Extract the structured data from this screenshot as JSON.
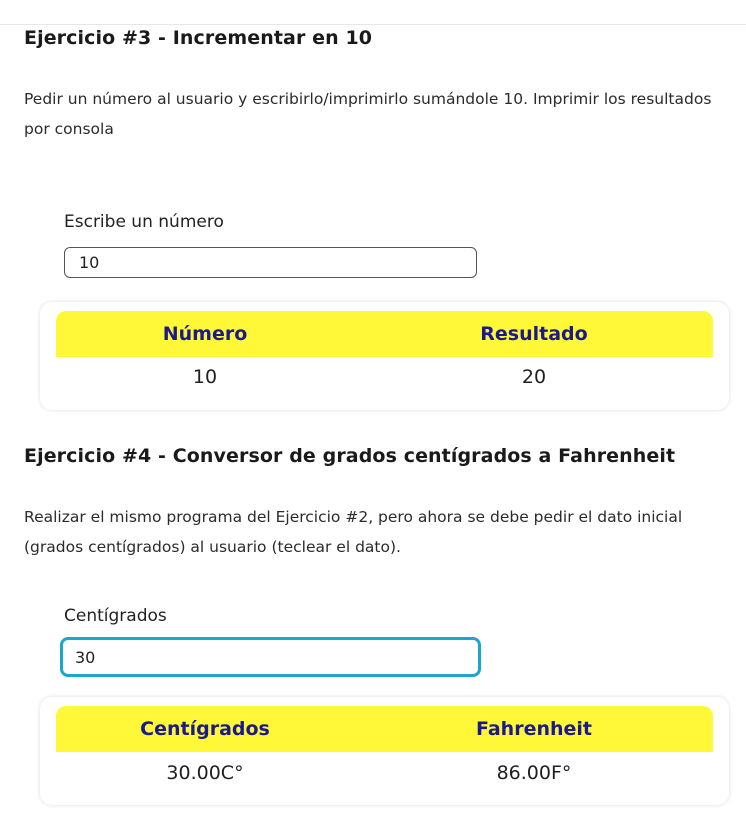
{
  "ex3": {
    "title": "Ejercicio #3 - Incrementar en 10",
    "description": "Pedir un número al usuario y escribirlo/imprimirlo sumándole 10. Imprimir los resultados por consola",
    "input_label": "Escribe un número",
    "input_value": "10",
    "table": {
      "headers": [
        "Número",
        "Resultado"
      ],
      "row": [
        "10",
        "20"
      ]
    }
  },
  "ex4": {
    "title": "Ejercicio #4 - Conversor de grados centígrados a Fahrenheit",
    "description": "Realizar el mismo programa del Ejercicio #2, pero ahora se debe pedir el dato inicial (grados centígrados) al usuario (teclear el dato).",
    "input_label": "Centígrados",
    "input_value": "30",
    "table": {
      "headers": [
        "Centígrados",
        "Fahrenheit"
      ],
      "row": [
        "30.00C°",
        "86.00F°"
      ]
    }
  },
  "colors": {
    "header_bg": "#fff838",
    "header_text": "#1a1a8a",
    "focus_border": "#1ea5cf"
  }
}
